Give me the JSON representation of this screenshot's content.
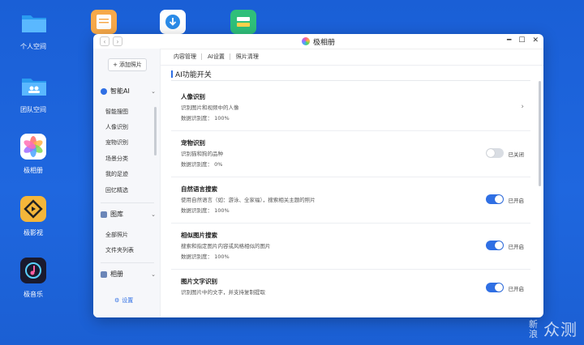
{
  "desktop": {
    "icons": [
      {
        "label": "个人空间",
        "icon": "folder-icon"
      },
      {
        "label": "团队空间",
        "icon": "team-folder-icon"
      },
      {
        "label": "极相册",
        "icon": "photos-icon"
      },
      {
        "label": "极影视",
        "icon": "video-icon"
      },
      {
        "label": "极音乐",
        "icon": "music-icon"
      }
    ],
    "top_icons": [
      "notes-icon",
      "download-icon",
      "storage-icon"
    ]
  },
  "window": {
    "title": "极相册",
    "controls": [
      "minimize-icon",
      "maximize-icon",
      "close-icon"
    ]
  },
  "sidebar": {
    "add_button": "添加照片",
    "sections": [
      {
        "label": "智能AI",
        "items": [
          "智能搜图",
          "人像识别",
          "宠物识别",
          "场景分类",
          "我的足迹",
          "回忆精选"
        ]
      },
      {
        "label": "图库",
        "items": [
          "全部照片",
          "文件夹列表"
        ]
      },
      {
        "label": "相册",
        "items": []
      }
    ],
    "settings": "设置"
  },
  "tabs": [
    "内容管理",
    "AI设置",
    "照片清理"
  ],
  "active_tab": "AI设置",
  "section_title": "AI功能开关",
  "features": [
    {
      "title": "人像识别",
      "desc": "识别图片和视频中的人像",
      "rate": "数据识别度： 100%",
      "control": "arrow"
    },
    {
      "title": "宠物识别",
      "desc": "识别猫和狗的品种",
      "rate": "数据识别度： 0%",
      "control": "toggle",
      "on": false,
      "state": "已关闭"
    },
    {
      "title": "自然语言搜索",
      "desc": "使用自然语言（如：游泳、全家福），搜索相关主题的照片",
      "rate": "数据识别度： 100%",
      "control": "toggle",
      "on": true,
      "state": "已开启"
    },
    {
      "title": "相似图片搜索",
      "desc": "搜索和指定图片内容或风格相似的图片",
      "rate": "数据识别度： 100%",
      "control": "toggle",
      "on": true,
      "state": "已开启"
    },
    {
      "title": "图片文字识别",
      "desc": "识别图片中的文字，并支持复制提取",
      "rate": "",
      "control": "toggle",
      "on": true,
      "state": "已开启"
    }
  ],
  "colors": {
    "accent": "#2f6fe4",
    "desktop": "#1f67df"
  },
  "watermark": {
    "line1": "新",
    "line2": "浪",
    "text": "众测"
  }
}
